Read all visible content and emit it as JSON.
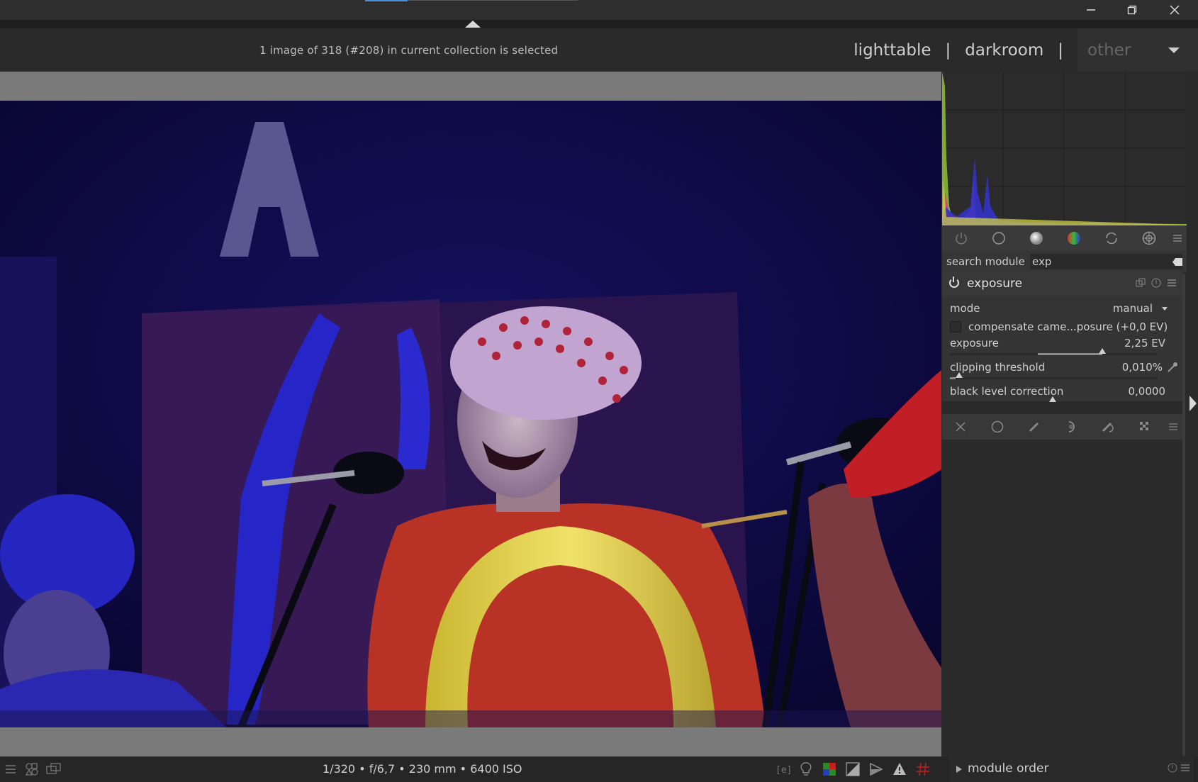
{
  "window": {
    "minimize_icon": "minimize-icon",
    "maximize_icon": "restore-icon",
    "close_icon": "close-icon"
  },
  "header": {
    "selection_info": "1 image of 318 (#208) in current collection is selected",
    "views": [
      "lighttable",
      "darkroom",
      "other"
    ],
    "separator": "|"
  },
  "module_groups": [
    "power-icon",
    "circle-icon",
    "tone-icon",
    "color-icon",
    "correct-icon",
    "effect-icon",
    "menu-icon"
  ],
  "search": {
    "label": "search module",
    "value": "exp"
  },
  "module": {
    "name": "exposure",
    "mode_label": "mode",
    "mode_value": "manual",
    "compensate_label": "compensate came...posure (+0,0 EV)",
    "exposure_label": "exposure",
    "exposure_value": "2,25 EV",
    "exposure_level": 0.6,
    "clipping_label": "clipping threshold",
    "clipping_value": "0,010%",
    "black_label": "black level correction",
    "black_value": "0,0000"
  },
  "bottom": {
    "exif": "1/320 • f/6,7 • 230 mm • 6400 ISO",
    "module_order_label": "module order"
  },
  "colors": {
    "accent": "#4a90d9",
    "background": "#2a2a2a"
  }
}
